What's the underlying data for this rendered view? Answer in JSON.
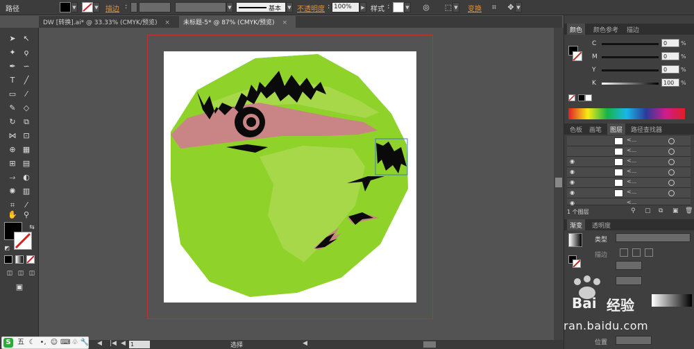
{
  "control_bar": {
    "object_type": "路径",
    "stroke_label": "描边",
    "stroke_profile": "基本",
    "opacity_label": "不透明度",
    "opacity_value": "100%",
    "style_label": "样式",
    "transform_label": "变换"
  },
  "tabs": [
    {
      "label": "DW [转换].ai* @ 33.33% (CMYK/预览)",
      "active": false
    },
    {
      "label": "未标题-5* @ 87% (CMYK/预览)",
      "active": true
    }
  ],
  "color_panel": {
    "tabs": [
      "颜色",
      "颜色参考",
      "描边"
    ],
    "sliders": [
      {
        "label": "C",
        "value": "0"
      },
      {
        "label": "M",
        "value": "0"
      },
      {
        "label": "Y",
        "value": "0"
      },
      {
        "label": "K",
        "value": "100"
      }
    ],
    "unit": "%"
  },
  "layers_panel": {
    "tabs": [
      "色板",
      "画笔",
      "图层",
      "路径查找器"
    ],
    "rows": [
      "<...",
      "<...",
      "<...",
      "<...",
      "<...",
      "<...",
      "<..."
    ],
    "count_label": "1 个图层"
  },
  "gradient_panel": {
    "tabs": [
      "渐变",
      "透明度"
    ],
    "type_label": "类型",
    "stroke_label": "描边",
    "position_label": "位置"
  },
  "status": {
    "zoom": "87%",
    "page": "1",
    "mode": "选择"
  },
  "watermark": {
    "text": "ran.baidu.com",
    "brand": "经验"
  },
  "ime": {
    "label": "五"
  },
  "colors": {
    "artwork_green": "#8ed22a",
    "artwork_light_green": "#a6d84a",
    "artwork_sky": "#3a9bd6",
    "artwork_pink": "#c98585",
    "artwork_black": "#0a0a0a",
    "bleed_red": "#c03030"
  }
}
